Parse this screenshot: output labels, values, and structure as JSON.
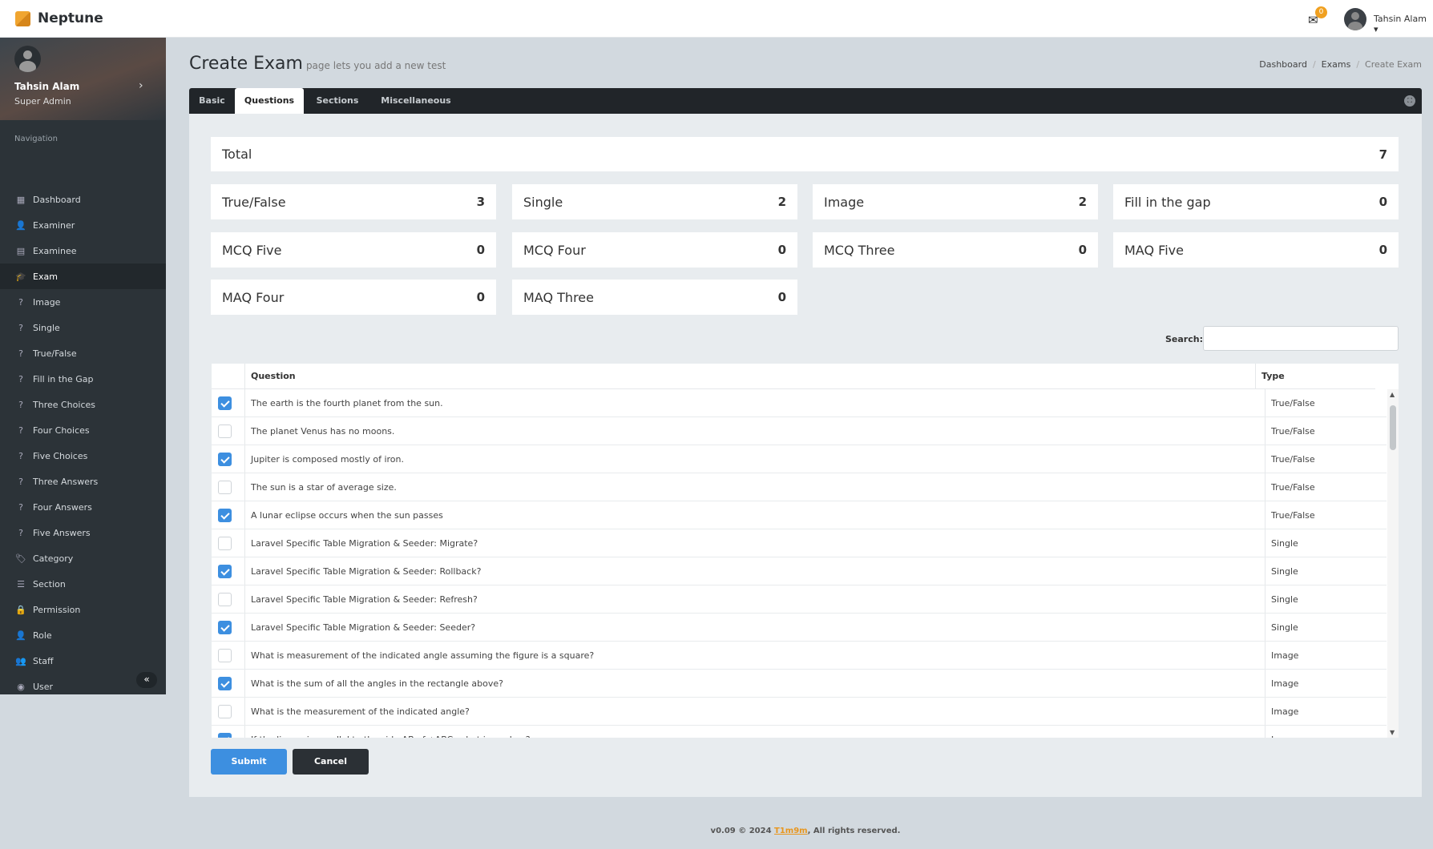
{
  "app": {
    "name": "Neptune",
    "notifications": "0",
    "user": "Tahsin Alam"
  },
  "profile": {
    "name": "Tahsin Alam",
    "role": "Super Admin"
  },
  "nav": {
    "label": "Navigation",
    "items": [
      {
        "label": "Dashboard",
        "icon": "dashboard-icon",
        "g": "▦"
      },
      {
        "label": "Examiner",
        "icon": "user-icon",
        "g": "👤"
      },
      {
        "label": "Examinee",
        "icon": "id-card-icon",
        "g": "▤"
      },
      {
        "label": "Exam",
        "icon": "graduation-cap-icon",
        "g": "🎓",
        "active": true
      },
      {
        "label": "Image",
        "icon": "question-circle-icon",
        "g": "?"
      },
      {
        "label": "Single",
        "icon": "question-icon",
        "g": "?"
      },
      {
        "label": "True/False",
        "icon": "question-circle-icon",
        "g": "?"
      },
      {
        "label": "Fill in the Gap",
        "icon": "question-icon",
        "g": "?"
      },
      {
        "label": "Three Choices",
        "icon": "question-circle-icon",
        "g": "?"
      },
      {
        "label": "Four Choices",
        "icon": "question-icon",
        "g": "?"
      },
      {
        "label": "Five Choices",
        "icon": "question-circle-icon",
        "g": "?"
      },
      {
        "label": "Three Answers",
        "icon": "question-icon",
        "g": "?"
      },
      {
        "label": "Four Answers",
        "icon": "question-circle-icon",
        "g": "?"
      },
      {
        "label": "Five Answers",
        "icon": "question-icon",
        "g": "?"
      },
      {
        "label": "Category",
        "icon": "tags-icon",
        "g": "🏷"
      },
      {
        "label": "Section",
        "icon": "list-icon",
        "g": "☰"
      },
      {
        "label": "Permission",
        "icon": "lock-icon",
        "g": "🔒"
      },
      {
        "label": "Role",
        "icon": "user-plus-icon",
        "g": "👤"
      },
      {
        "label": "Staff",
        "icon": "users-icon",
        "g": "👥"
      },
      {
        "label": "User",
        "icon": "user-circle-icon",
        "g": "◉"
      }
    ]
  },
  "page": {
    "title": "Create Exam",
    "subtitle": "page lets you add a new test"
  },
  "breadcrumb": [
    "Dashboard",
    "Exams",
    "Create Exam"
  ],
  "tabs": [
    "Basic",
    "Questions",
    "Sections",
    "Miscellaneous"
  ],
  "active_tab": "Questions",
  "total": {
    "label": "Total",
    "value": "7"
  },
  "stats": [
    {
      "label": "True/False",
      "value": "3"
    },
    {
      "label": "Single",
      "value": "2"
    },
    {
      "label": "Image",
      "value": "2"
    },
    {
      "label": "Fill in the gap",
      "value": "0"
    },
    {
      "label": "MCQ Five",
      "value": "0"
    },
    {
      "label": "MCQ Four",
      "value": "0"
    },
    {
      "label": "MCQ Three",
      "value": "0"
    },
    {
      "label": "MAQ Five",
      "value": "0"
    },
    {
      "label": "MAQ Four",
      "value": "0"
    },
    {
      "label": "MAQ Three",
      "value": "0"
    }
  ],
  "search": {
    "label": "Search:",
    "value": ""
  },
  "table": {
    "headers": [
      "Question",
      "Type"
    ],
    "rows": [
      {
        "q": "The earth is the fourth planet from the sun.",
        "t": "True/False",
        "c": true
      },
      {
        "q": "The planet Venus has no moons.",
        "t": "True/False",
        "c": false
      },
      {
        "q": "Jupiter is composed mostly of iron.",
        "t": "True/False",
        "c": true
      },
      {
        "q": "The sun is a star of average size.",
        "t": "True/False",
        "c": false
      },
      {
        "q": "A lunar eclipse occurs when the sun passes",
        "t": "True/False",
        "c": true
      },
      {
        "q": "Laravel Specific Table Migration & Seeder: Migrate?",
        "t": "Single",
        "c": false
      },
      {
        "q": "Laravel Specific Table Migration & Seeder: Rollback?",
        "t": "Single",
        "c": true
      },
      {
        "q": "Laravel Specific Table Migration & Seeder: Refresh?",
        "t": "Single",
        "c": false
      },
      {
        "q": "Laravel Specific Table Migration & Seeder: Seeder?",
        "t": "Single",
        "c": true
      },
      {
        "q": "What is measurement of the indicated angle assuming the figure is a square?",
        "t": "Image",
        "c": false
      },
      {
        "q": "What is the sum of all the angles in the rectangle above?",
        "t": "Image",
        "c": true
      },
      {
        "q": "What is the measurement of the indicated angle?",
        "t": "Image",
        "c": false
      },
      {
        "q": "If the line m is parallel to the side AB of △ABC, what is angle a?",
        "t": "Image",
        "c": true
      }
    ]
  },
  "buttons": {
    "submit": "Submit",
    "cancel": "Cancel"
  },
  "footer": {
    "prefix": "v0.09 © 2024 ",
    "link": "T1m9m",
    "suffix": ", All rights reserved."
  },
  "colors": {
    "accent": "#f0a020",
    "primary": "#3d8fe0",
    "dark": "#212529"
  }
}
